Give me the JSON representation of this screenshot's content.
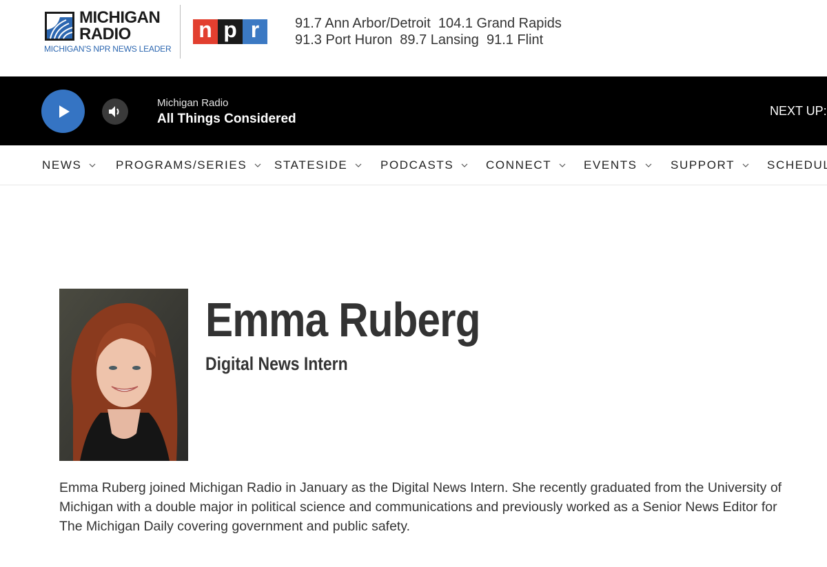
{
  "header": {
    "logo_line1": "MICHIGAN",
    "logo_line2": "RADIO",
    "logo_tagline": "MICHIGAN'S NPR NEWS LEADER",
    "npr_letters": [
      "n",
      "p",
      "r"
    ],
    "stations_line1": "91.7 Ann Arbor/Detroit  104.1 Grand Rapids",
    "stations_line2": "91.3 Port Huron  89.7 Lansing  91.1 Flint"
  },
  "player": {
    "station": "Michigan Radio",
    "program": "All Things Considered",
    "next_up": "NEXT UP:",
    "colors": {
      "bar": "#000000",
      "play": "#3574c3"
    }
  },
  "nav": {
    "items": [
      {
        "label": "NEWS"
      },
      {
        "label": "PROGRAMS/SERIES"
      },
      {
        "label": "STATESIDE"
      },
      {
        "label": "PODCASTS"
      },
      {
        "label": "CONNECT"
      },
      {
        "label": "EVENTS"
      },
      {
        "label": "SUPPORT"
      },
      {
        "label": "SCHEDULE"
      }
    ]
  },
  "profile": {
    "name": "Emma Ruberg",
    "title": "Digital News Intern",
    "bio": "Emma Ruberg joined Michigan Radio in January as the Digital News Intern. She recently graduated from the University of Michigan with a double major in political science and communications and previously worked as a Senior News Editor for The Michigan Daily covering government and public safety."
  },
  "brand_colors": {
    "npr_red": "#e23f2f",
    "npr_black": "#1a1a1a",
    "npr_blue": "#3b79c3",
    "tagline_blue": "#2b66b0"
  }
}
